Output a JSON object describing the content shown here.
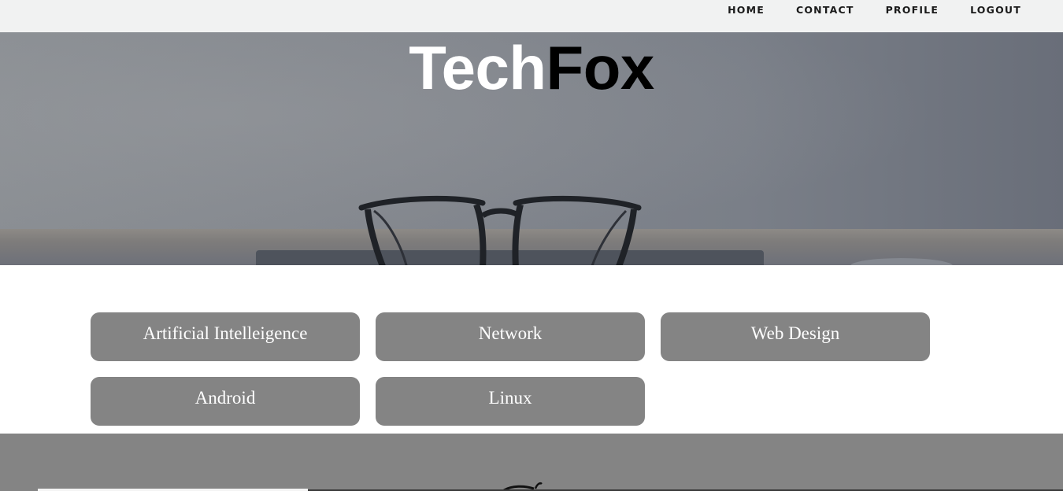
{
  "nav": {
    "items": [
      {
        "label": "HOME"
      },
      {
        "label": "CONTACT"
      },
      {
        "label": "PROFILE"
      },
      {
        "label": "LOGOUT"
      }
    ]
  },
  "hero": {
    "brand_part1": "Tech",
    "brand_part2": "Fox",
    "image_subject": "eyeglasses-on-desk"
  },
  "categories": [
    {
      "label": "Artificial Intelleigence"
    },
    {
      "label": "Network"
    },
    {
      "label": "Web Design"
    },
    {
      "label": "Android"
    },
    {
      "label": "Linux"
    }
  ],
  "colors": {
    "navbar_bg": "#f1f2f2",
    "category_bg": "#848484",
    "category_text": "#ffffff",
    "brand_tech": "#ffffff",
    "brand_fox": "#000000",
    "footer_bg": "#848484"
  }
}
